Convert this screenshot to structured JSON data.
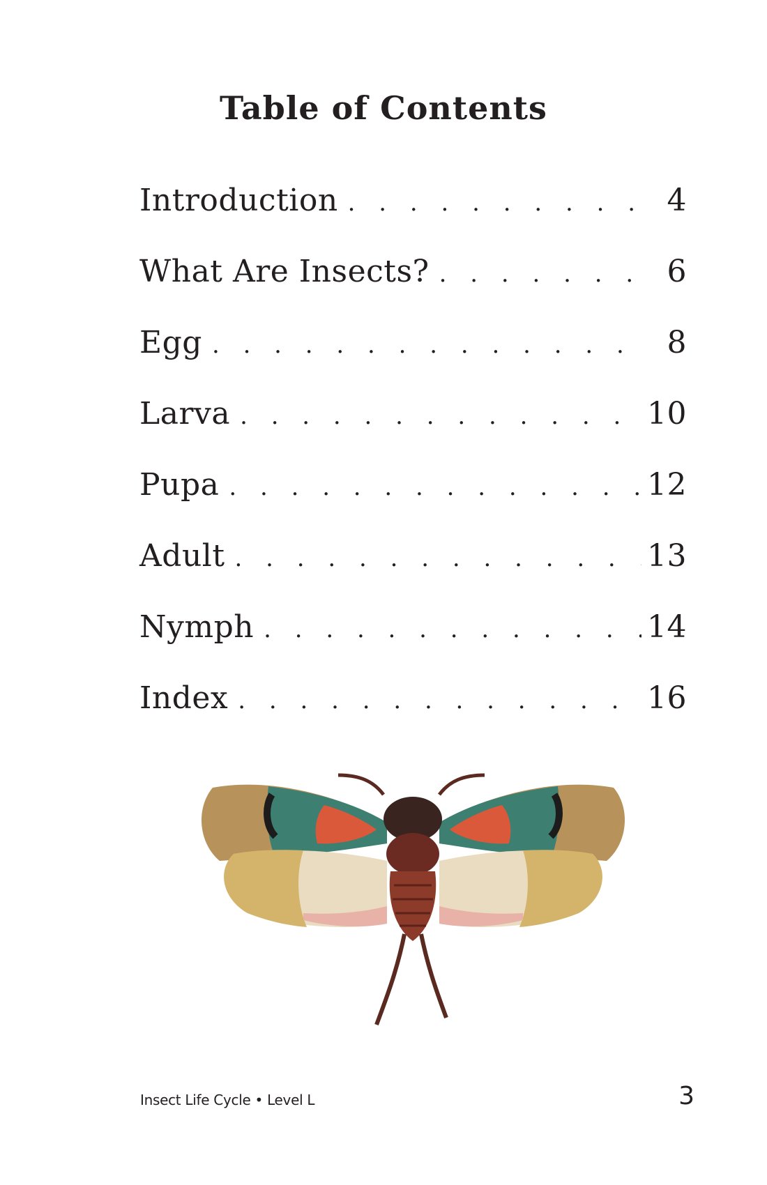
{
  "title": "Table of Contents",
  "toc": [
    {
      "label": "Introduction",
      "page": "4"
    },
    {
      "label": "What Are Insects?",
      "page": "6"
    },
    {
      "label": "Egg",
      "page": "8"
    },
    {
      "label": "Larva",
      "page": "10"
    },
    {
      "label": "Pupa",
      "page": "12"
    },
    {
      "label": "Adult",
      "page": "13"
    },
    {
      "label": "Nymph",
      "page": "14"
    },
    {
      "label": "Index",
      "page": "16"
    }
  ],
  "illustration": {
    "icon": "lanternfly-insect-illustration"
  },
  "footer": {
    "book_info": "Insect Life Cycle • Level L",
    "page_number": "3"
  }
}
